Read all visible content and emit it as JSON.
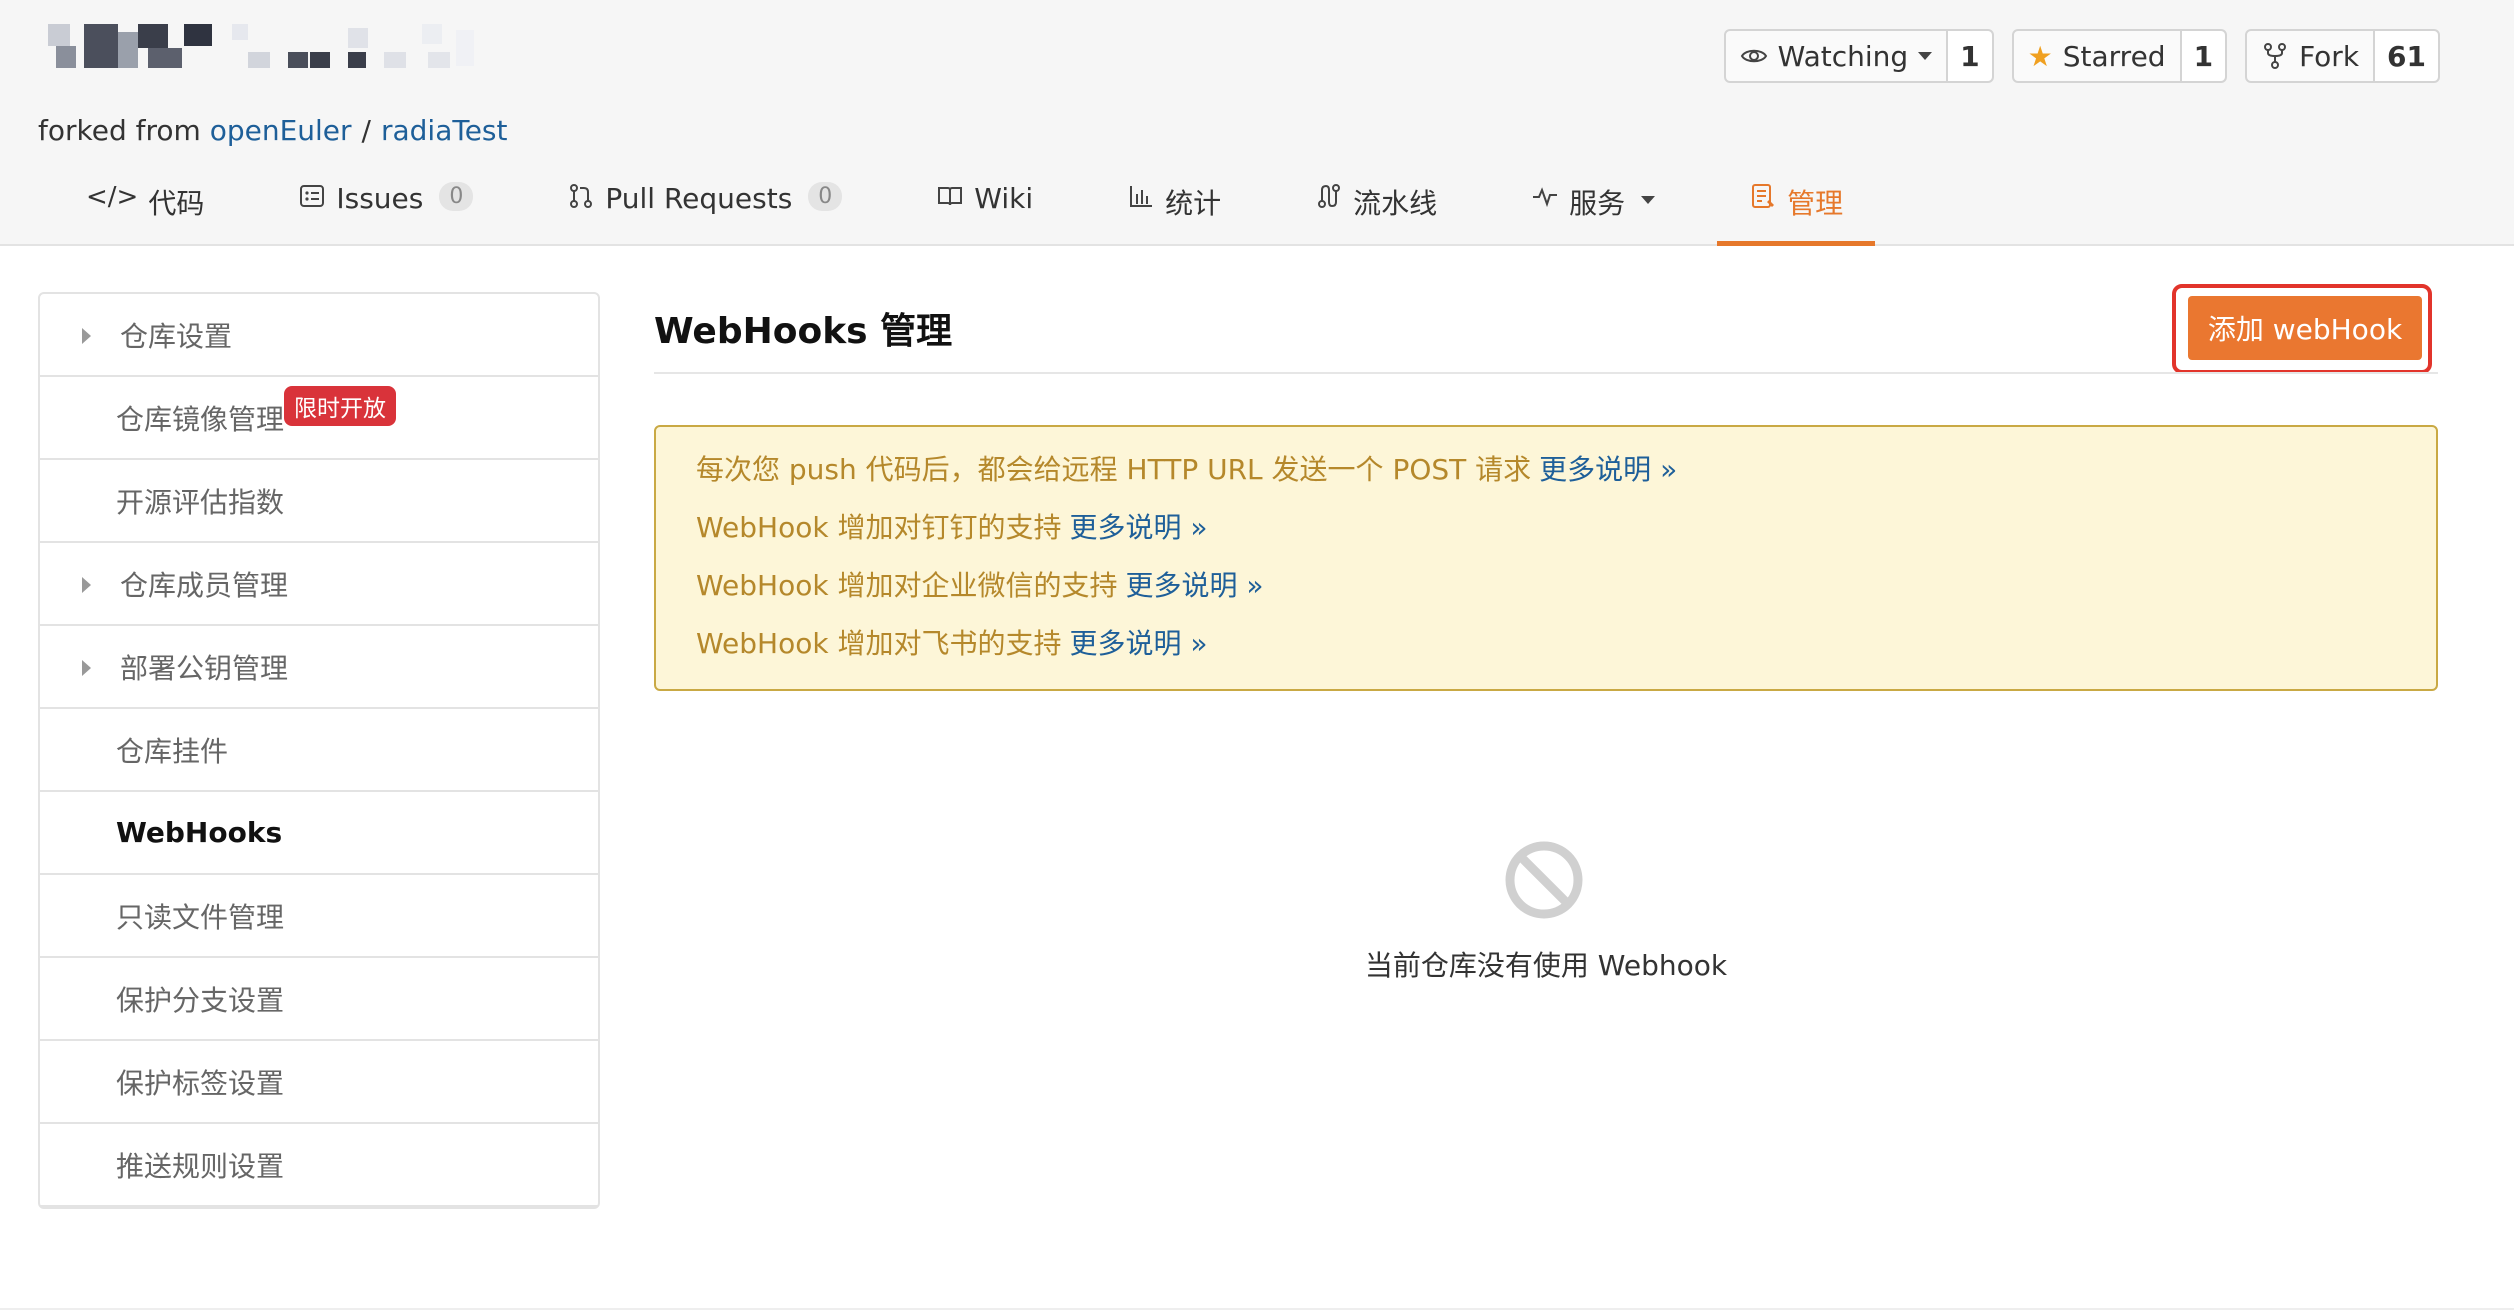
{
  "repo_header": {
    "forked_prefix": "forked from",
    "forked_owner": "openEuler",
    "forked_sep": "/",
    "forked_repo": "radiaTest"
  },
  "actions": {
    "watching": {
      "label": "Watching",
      "count": "1"
    },
    "starred": {
      "label": "Starred",
      "count": "1"
    },
    "fork": {
      "label": "Fork",
      "count": "61"
    }
  },
  "tabs": [
    {
      "label": "代码",
      "icon": "code-icon"
    },
    {
      "label": "Issues",
      "count": "0",
      "icon": "issues-icon"
    },
    {
      "label": "Pull Requests",
      "count": "0",
      "icon": "pull-request-icon"
    },
    {
      "label": "Wiki",
      "icon": "book-icon"
    },
    {
      "label": "统计",
      "icon": "bar-chart-icon"
    },
    {
      "label": "流水线",
      "icon": "pipeline-icon"
    },
    {
      "label": "服务",
      "icon": "pulse-icon"
    },
    {
      "label": "管理",
      "icon": "manage-icon",
      "active": true
    }
  ],
  "sidebar": {
    "items": [
      {
        "label": "仓库设置"
      },
      {
        "label": "仓库镜像管理"
      },
      {
        "label": "开源评估指数"
      },
      {
        "label": "仓库成员管理"
      },
      {
        "label": "部署公钥管理"
      },
      {
        "label": "仓库挂件"
      },
      {
        "label": "WebHooks"
      },
      {
        "label": "只读文件管理"
      },
      {
        "label": "保护分支设置"
      },
      {
        "label": "保护标签设置"
      },
      {
        "label": "推送规则设置"
      }
    ],
    "badge": "限时开放"
  },
  "content": {
    "title": "WebHooks 管理",
    "add_button": "添加 webHook",
    "notices": [
      {
        "text": "每次您 push 代码后，都会给远程 HTTP URL 发送一个 POST 请求",
        "link": "更多说明 »"
      },
      {
        "text": "WebHook 增加对钉钉的支持",
        "link": "更多说明 »"
      },
      {
        "text": "WebHook 增加对企业微信的支持",
        "link": "更多说明 »"
      },
      {
        "text": "WebHook 增加对飞书的支持",
        "link": "更多说明 »"
      }
    ],
    "empty_text": "当前仓库没有使用 Webhook"
  },
  "colors": {
    "accent": "#e6782b",
    "link": "#1e5f99",
    "notice_bg": "#fdf6d8",
    "notice_text": "#b5882b",
    "badge": "#d9333a",
    "highlight_border": "#e2342b"
  }
}
